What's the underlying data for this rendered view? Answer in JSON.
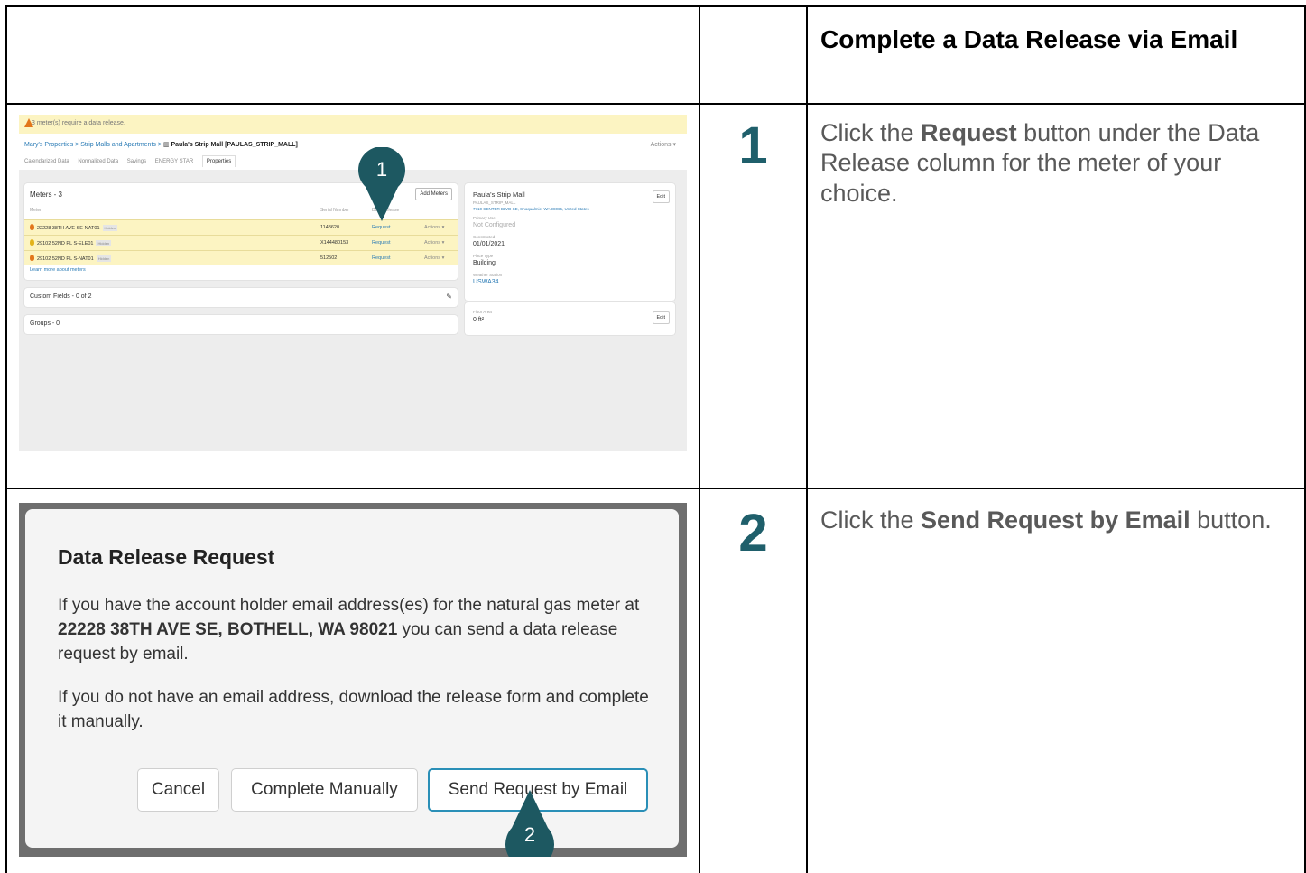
{
  "header": {
    "title": "Complete a Data Release via Email"
  },
  "steps": [
    {
      "number": "1",
      "text_before": "Click the ",
      "text_bold": "Request",
      "text_after": " button under the Data Release column for the meter of your choice."
    },
    {
      "number": "2",
      "text_before": "Click the ",
      "text_bold": "Send Request by Email",
      "text_after": " button."
    }
  ],
  "screenshot1": {
    "banner": "3 meter(s) require a data release.",
    "breadcrumb": {
      "item1": "Mary's Properties",
      "sep1": ">",
      "item2": "Strip Malls and Apartments",
      "sep2": ">",
      "current": "Paula's Strip Mall [PAULAS_STRIP_MALL]"
    },
    "actions_menu": "Actions ▾",
    "tabs": [
      "Calendarized Data",
      "Normalized Data",
      "Savings",
      "ENERGY STAR",
      "Properties"
    ],
    "meters": {
      "title": "Meters - 3",
      "add_button": "Add Meters",
      "headers": {
        "meter": "Meter",
        "serial": "Serial Number",
        "release": "Data Release"
      },
      "rows": [
        {
          "name": "22228 38TH AVE SE-NAT01",
          "tag": "Hidden",
          "serial": "1148620",
          "request": "Request",
          "actions": "Actions ▾"
        },
        {
          "name": "29102 52ND PL S-ELE01",
          "tag": "Hidden",
          "serial": "X144480153",
          "request": "Request",
          "actions": "Actions ▾"
        },
        {
          "name": "29102 52ND PL S-NAT01",
          "tag": "Hidden",
          "serial": "512502",
          "request": "Request",
          "actions": "Actions ▾"
        }
      ],
      "learn_more": "Learn more about meters"
    },
    "custom_fields": "Custom Fields - 0 of 2",
    "groups": "Groups - 0",
    "property": {
      "name": "Paula's Strip Mall",
      "code": "PAULAS_STRIP_MALL",
      "address": "7710 CENTER BLVD SE, Snoqualmie, WA 98065, United States",
      "edit": "Edit",
      "primary_use_label": "Primary Use",
      "primary_use_value": "Not Configured",
      "constructed_label": "Constructed",
      "constructed_value": "01/01/2021",
      "place_type_label": "Place Type",
      "place_type_value": "Building",
      "weather_label": "Weather Station",
      "weather_value": "USWA34",
      "floor_area_label": "Floor Area",
      "floor_area_value": "0 ft²",
      "edit2": "Edit"
    },
    "callout": "1"
  },
  "screenshot2": {
    "modal_title": "Data Release Request",
    "p1_before": "If you have the account holder email address(es) for the natural gas meter at ",
    "p1_bold": "22228 38TH AVE SE, BOTHELL, WA 98021",
    "p1_after": " you can send a data release request by email.",
    "p2": "If you do not have an email address, download the release form and complete it manually.",
    "cancel_button": "Cancel",
    "manual_button": "Complete Manually",
    "email_button": "Send Request by Email",
    "callout": "2"
  },
  "colors": {
    "step_number": "#1f5f6b",
    "callout": "#1d5861",
    "banner": "#fcf4c2",
    "link": "#2a7bb5",
    "primary_border": "#2a8fb7"
  }
}
